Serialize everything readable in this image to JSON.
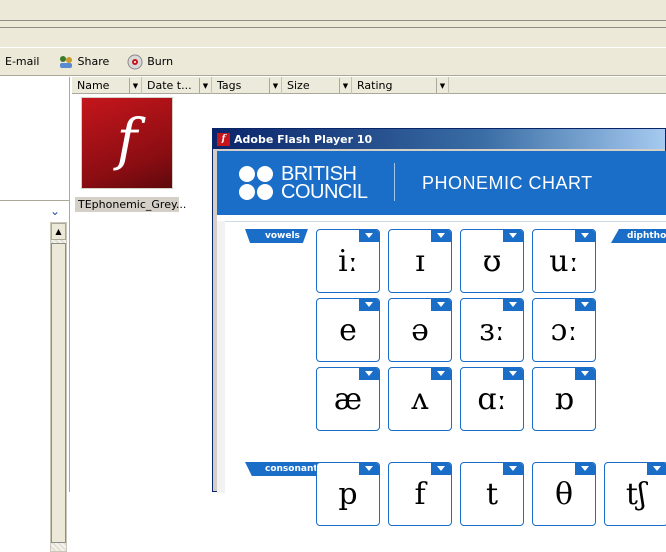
{
  "toolbar": {
    "email_label": "E-mail",
    "share_label": "Share",
    "burn_label": "Burn"
  },
  "columns": [
    {
      "label": "Name"
    },
    {
      "label": "Date t..."
    },
    {
      "label": "Tags"
    },
    {
      "label": "Size"
    },
    {
      "label": "Rating"
    }
  ],
  "file": {
    "name": "TEphonemic_Grey...",
    "icon": "flash-file-icon"
  },
  "flash_window": {
    "title": "Adobe Flash Player 10",
    "logo_line1": "BRITISH",
    "logo_line2": "COUNCIL",
    "chart_title": "PHONEMIC CHART",
    "tags": {
      "vowels": "vowels",
      "diphthongs": "diphthongs",
      "consonants": "consonants"
    },
    "vowels": [
      [
        "iː",
        "ɪ",
        "ʊ",
        "uː"
      ],
      [
        "e",
        "ə",
        "ɜː",
        "ɔː"
      ],
      [
        "æ",
        "ʌ",
        "ɑː",
        "ɒ"
      ]
    ],
    "consonants_partial": [
      "p",
      "f",
      "t",
      "θ",
      "tʃ"
    ]
  },
  "colors": {
    "accent": "#1a6ec8",
    "xp_face": "#ece9d8",
    "flash_red": "#c4161c"
  }
}
